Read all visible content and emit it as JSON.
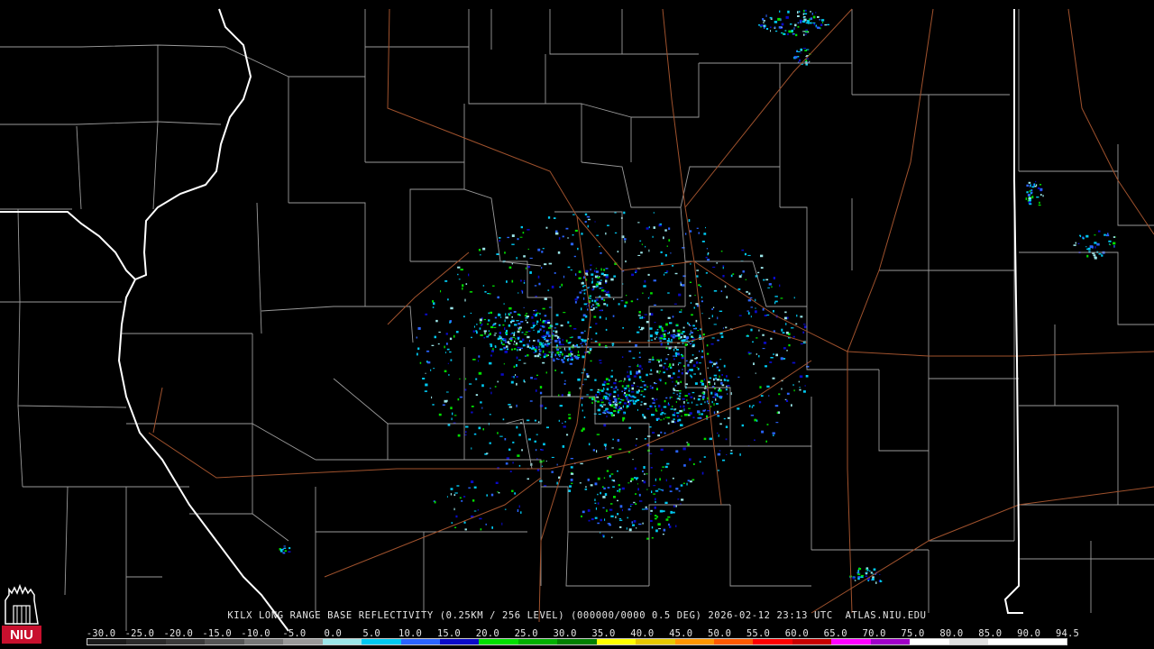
{
  "caption": "KILX LONG RANGE BASE REFLECTIVITY (0.25KM / 256 LEVEL) (000000/0000 0.5 DEG) 2026-02-12 23:13 UTC  ATLAS.NIU.EDU",
  "logo": {
    "text": "NIU",
    "color": "#c8102e"
  },
  "colors": {
    "county_lines": "#9a9a9a",
    "state_lines": "#ffffff",
    "highways": "#a0522d",
    "background": "#000000"
  },
  "scale": {
    "labels": [
      "-30.0",
      "-25.0",
      "-20.0",
      "-15.0",
      "-10.0",
      "-5.0",
      "0.0",
      "5.0",
      "10.0",
      "15.0",
      "20.0",
      "25.0",
      "30.0",
      "35.0",
      "40.0",
      "45.0",
      "50.0",
      "55.0",
      "60.0",
      "65.0",
      "70.0",
      "75.0",
      "80.0",
      "85.0",
      "90.0",
      "94.5"
    ],
    "colors": [
      "#1a1a1a",
      "#2a2a2a",
      "#3a3a3a",
      "#555555",
      "#777777",
      "#999999",
      "#9be5e8",
      "#00c8f0",
      "#2a64ff",
      "#0a0ac8",
      "#00e000",
      "#00b000",
      "#008000",
      "#ffff00",
      "#e6c800",
      "#ff9600",
      "#ff5a00",
      "#ff0000",
      "#c80000",
      "#ff00ff",
      "#a000c8",
      "#ffffff",
      "#e0e0e0",
      "#ffffff",
      "#ffffff"
    ]
  }
}
